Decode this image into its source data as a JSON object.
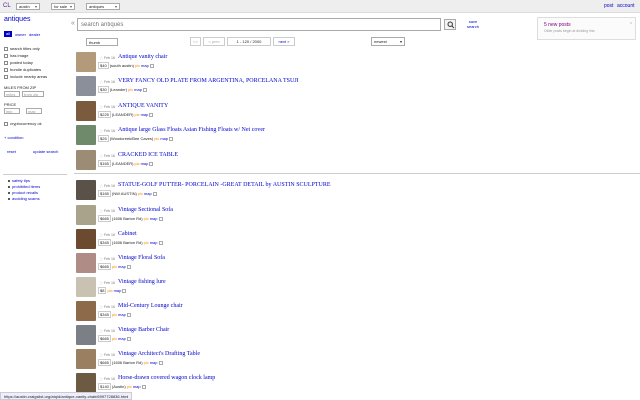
{
  "topbar": {
    "logo": "CL",
    "location": "austin",
    "section": "for sale",
    "category": "antiques",
    "post_label": "post",
    "account_label": "account"
  },
  "sidebar": {
    "title": "antiques",
    "toggles": [
      "all",
      "owner",
      "dealer"
    ],
    "filters": [
      "search titles only",
      "has image",
      "posted today",
      "bundle duplicates",
      "include nearby areas"
    ],
    "miles_label": "MILES FROM ZIP",
    "miles_placeholder": "miles",
    "zip_placeholder": "from zip",
    "price_label": "PRICE",
    "min_placeholder": "min",
    "max_placeholder": "max",
    "crypto_label": "cryptocurrency ok",
    "condition_label": "+ condition",
    "reset_label": "reset",
    "update_label": "update search",
    "help_links": [
      "safety tips",
      "prohibited items",
      "product recalls",
      "avoiding scams"
    ]
  },
  "search": {
    "placeholder": "search antiques",
    "save_label_1": "save",
    "save_label_2": "search"
  },
  "alert": {
    "title": "5 new posts",
    "subtitle": "Older posts begin at dividing line.",
    "close": "x"
  },
  "toolbar": {
    "view": "thumb",
    "first": "<<",
    "prev": "< prev",
    "range": "1 - 120 / 2000",
    "next": "next >",
    "sort": "newest"
  },
  "icons": {
    "collapse": "«",
    "search": "magnifier",
    "star": "☆"
  },
  "listings": [
    {
      "date": "Feb 16",
      "title": "Antique vanity chair",
      "price": "$40",
      "location": "(south austin)",
      "has_pic": true,
      "color": "#b39a7a"
    },
    {
      "date": "Feb 16",
      "title": "VERY FANCY OLD PLATE FROM ARGENTINA, PORCELANA TSUJI",
      "price": "$30",
      "location": "(Leander)",
      "has_pic": true,
      "color": "#8a8f9a"
    },
    {
      "date": "Feb 16",
      "title": "ANTIQUE VANITY",
      "price": "$225",
      "location": "(LEANDER)",
      "has_pic": true,
      "color": "#7a5b3e"
    },
    {
      "date": "Feb 16",
      "title": "Antique large Glass Floats Asian Fishing Floats w/ Net cover",
      "price": "$25",
      "location": "(Woodcreek/Bee Caves)",
      "has_pic": true,
      "color": "#6e8a6a"
    },
    {
      "date": "Feb 16",
      "title": "CRACKED ICE TABLE",
      "price": "$165",
      "location": "(LEANDER)",
      "has_pic": true,
      "color": "#9c8b75"
    },
    {
      "date": "Feb 16",
      "title": "STATUE-GOLF PUTTER- PORCELAIN -GREAT DETAIL by AUSTIN SCULPTURE",
      "price": "$165",
      "location": "(NW AUSTIN)",
      "has_pic": true,
      "color": "#5a5248"
    },
    {
      "date": "Feb 16",
      "title": "Vintage Sectional Sofa",
      "price": "$665",
      "location": "(1606 Barton Rd)",
      "has_pic": true,
      "color": "#a9a38c"
    },
    {
      "date": "Feb 16",
      "title": "Cabinet",
      "price": "$345",
      "location": "(1606 Barton Rd)",
      "has_pic": true,
      "color": "#6b4a2f"
    },
    {
      "date": "Feb 16",
      "title": "Vintage Floral Sofa",
      "price": "$665",
      "location": "",
      "has_pic": true,
      "color": "#b08c86"
    },
    {
      "date": "Feb 16",
      "title": "Vintage fishing lure",
      "price": "$8",
      "location": "",
      "has_pic": true,
      "color": "#c9c2b3"
    },
    {
      "date": "Feb 16",
      "title": "Mid-Century Lounge chair",
      "price": "$345",
      "location": "",
      "has_pic": true,
      "color": "#8d6b4a"
    },
    {
      "date": "Feb 16",
      "title": "Vintage Barber Chair",
      "price": "$665",
      "location": "",
      "has_pic": true,
      "color": "#7b7f86"
    },
    {
      "date": "Feb 16",
      "title": "Vintage Architect's Drafting Table",
      "price": "$665",
      "location": "(1606 Barton Rd)",
      "has_pic": true,
      "color": "#9a8060"
    },
    {
      "date": "Feb 16",
      "title": "Horse-drawn covered wagon clock lamp",
      "price": "$140",
      "location": "(Austin)",
      "has_pic": true,
      "color": "#6d5a43"
    }
  ],
  "row_labels": {
    "pic": "pic",
    "map": "map"
  },
  "statusbar": "https://austin.craigslist.org/atq/d/antique-vanity-chair/6997728836.html"
}
